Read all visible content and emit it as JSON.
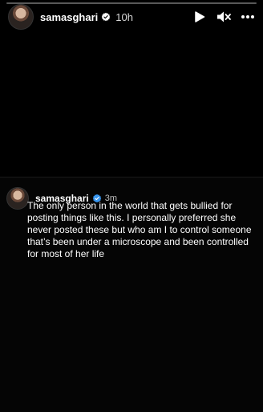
{
  "story": {
    "username": "samasghari",
    "time": "10h",
    "progress": 0
  },
  "post": {
    "username": "samasghari",
    "time": "3m",
    "text": "The only person in the world that gets bullied for posting things like this. I personally preferred she never posted  these but who am I to control someone that’s been under a microscope and been controlled for most of her life"
  },
  "icons": {
    "verified": "verified-badge-icon",
    "play": "play-icon",
    "mute": "speaker-muted-icon",
    "more": "more-horizontal-icon"
  },
  "colors": {
    "background": "#000000",
    "verified_blue": "#3897f0"
  }
}
